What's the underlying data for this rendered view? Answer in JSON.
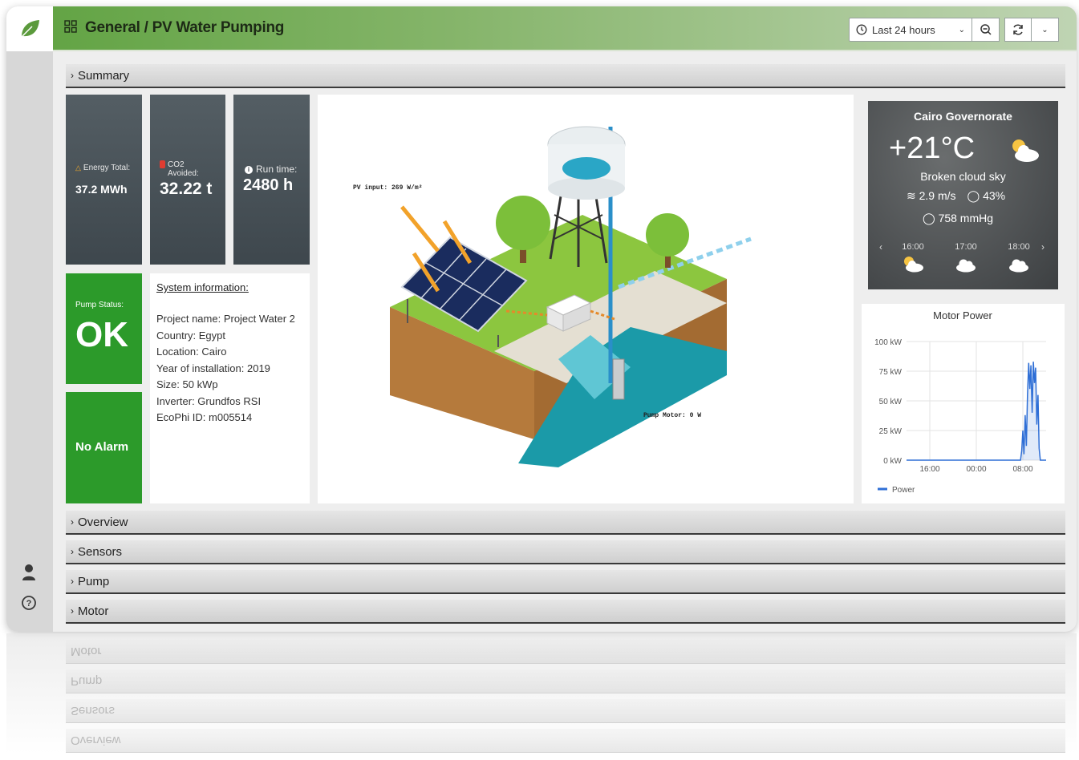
{
  "topbar": {
    "title": "General / PV Water Pumping",
    "time_range": "Last 24 hours"
  },
  "rows": {
    "summary": "Summary",
    "overview": "Overview",
    "sensors": "Sensors",
    "pump": "Pump",
    "motor": "Motor"
  },
  "stats": {
    "energy_label": "Energy Total:",
    "energy_value": "37.2 MWh",
    "co2_label": "CO2 Avoided:",
    "co2_value": "32.22 t",
    "runtime_label": "Run time:",
    "runtime_value": "2480 h"
  },
  "pump_status": {
    "label": "Pump Status:",
    "value": "OK"
  },
  "alarm": {
    "label": "No Alarm"
  },
  "system_info": {
    "title": "System information:",
    "lines": [
      "Project name: Project Water 2",
      "Country: Egypt",
      "Location: Cairo",
      "Year of installation: 2019",
      "Size: 50 kWp",
      "Inverter: Grundfos RSI",
      "EcoPhi ID: m005514"
    ]
  },
  "diagram": {
    "pv_input": "PV input: 269 W/m²",
    "pump_motor": "Pump Motor: 0 W"
  },
  "weather": {
    "location": "Cairo Governorate",
    "temperature": "+21°C",
    "condition": "Broken cloud sky",
    "wind": "2.9 m/s",
    "humidity": "43%",
    "pressure": "758 mmHg",
    "forecast": [
      {
        "time": "16:00",
        "icon": "partly-cloudy-icon"
      },
      {
        "time": "17:00",
        "icon": "cloud-icon"
      },
      {
        "time": "18:00",
        "icon": "cloud-icon"
      }
    ]
  },
  "colors": {
    "brand_green": "#63a445",
    "card_dark": "#4a5358",
    "status_green": "#2c9a2a",
    "series_blue": "#2f6fd6"
  },
  "chart_data": {
    "type": "line",
    "title": "Motor Power",
    "y_ticks": [
      "100 kW",
      "75 kW",
      "50 kW",
      "25 kW",
      "0 kW"
    ],
    "x_ticks": [
      "16:00",
      "00:00",
      "08:00"
    ],
    "ylim": [
      0,
      100
    ],
    "x_unit": "hours since 12:00",
    "xlim": [
      0,
      24
    ],
    "legend": "bottom-left",
    "grid": true,
    "series": [
      {
        "name": "Power",
        "x": [
          0,
          19.6,
          19.8,
          20.0,
          20.2,
          20.4,
          20.6,
          20.8,
          21.0,
          21.2,
          21.4,
          21.6,
          21.8,
          22.0,
          22.2,
          22.4,
          22.6,
          22.8,
          23.0,
          24
        ],
        "y": [
          0,
          0,
          8,
          25,
          5,
          38,
          12,
          55,
          82,
          60,
          80,
          40,
          83,
          65,
          78,
          30,
          55,
          10,
          0,
          0
        ]
      }
    ]
  }
}
